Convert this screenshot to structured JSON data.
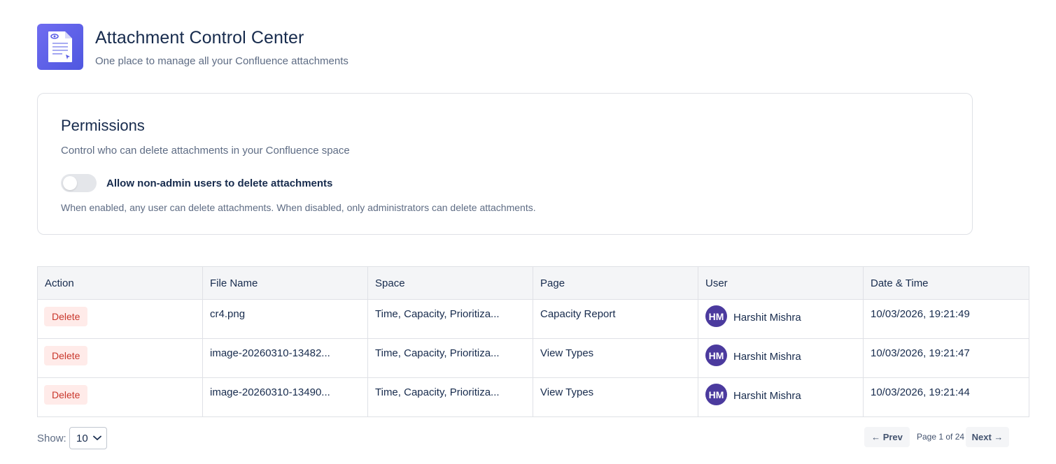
{
  "header": {
    "title": "Attachment Control Center",
    "subtitle": "One place to manage all your Confluence attachments",
    "icon": "document-icon"
  },
  "permissions": {
    "title": "Permissions",
    "description": "Control who can delete attachments in your Confluence space",
    "toggle_label": "Allow non-admin users to delete attachments",
    "toggle_on": false,
    "note": "When enabled, any user can delete attachments. When disabled, only administrators can delete attachments."
  },
  "table": {
    "columns": [
      "Action",
      "File Name",
      "Space",
      "Page",
      "User",
      "Date & Time"
    ],
    "rows": [
      {
        "action": "Delete",
        "file_name": "cr4.png",
        "space": "Time, Capacity, Prioritiza...",
        "page": "Capacity Report",
        "user_initials": "HM",
        "user_name": "Harshit Mishra",
        "datetime": "10/03/2026, 19:21:49"
      },
      {
        "action": "Delete",
        "file_name": "image-20260310-13482...",
        "space": "Time, Capacity, Prioritiza...",
        "page": "View Types",
        "user_initials": "HM",
        "user_name": "Harshit Mishra",
        "datetime": "10/03/2026, 19:21:47"
      },
      {
        "action": "Delete",
        "file_name": "image-20260310-13490...",
        "space": "Time, Capacity, Prioritiza...",
        "page": "View Types",
        "user_initials": "HM",
        "user_name": "Harshit Mishra",
        "datetime": "10/03/2026, 19:21:44"
      }
    ]
  },
  "footer": {
    "show_label": "Show:",
    "page_size": "10",
    "prev_label": "← Prev",
    "page_info": "Page 1 of 24",
    "next_label": "Next →"
  },
  "colors": {
    "accent": "#5a5fe6",
    "avatar": "#4b3a9e",
    "delete_bg": "#ffebe9",
    "delete_text": "#c9372c"
  }
}
